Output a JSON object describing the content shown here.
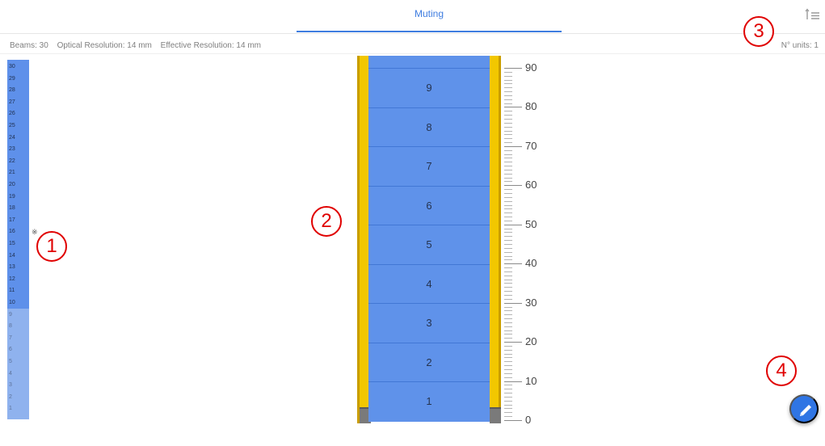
{
  "tabs": [
    {
      "label": "Muting",
      "active": true
    }
  ],
  "toolbar": {
    "sort_icon": "sort-list-icon"
  },
  "info": {
    "beams": "Beams: 30",
    "optical_resolution": "Optical Resolution: 14 mm",
    "effective_resolution": "Effective Resolution: 14 mm",
    "units": "N° units: 1"
  },
  "beams_list": [
    "30",
    "29",
    "28",
    "27",
    "26",
    "25",
    "24",
    "23",
    "22",
    "21",
    "20",
    "19",
    "18",
    "17",
    "16",
    "15",
    "14",
    "13",
    "12",
    "11",
    "10",
    "9",
    "8",
    "7",
    "6",
    "5",
    "4",
    "3",
    "2",
    "1"
  ],
  "callouts": [
    "1",
    "2",
    "3",
    "4"
  ],
  "segments": [
    "9",
    "8",
    "7",
    "6",
    "5",
    "4",
    "3",
    "2",
    "1"
  ],
  "ruler_labels": [
    "90",
    "80",
    "70",
    "60",
    "50",
    "40",
    "30",
    "20",
    "10",
    "0"
  ],
  "colors": {
    "accent": "#3f7de0",
    "segment": "#5f92ea",
    "rail": "#f2c700",
    "callout": "#e00000"
  },
  "fab": {
    "icon": "pencil-icon"
  }
}
